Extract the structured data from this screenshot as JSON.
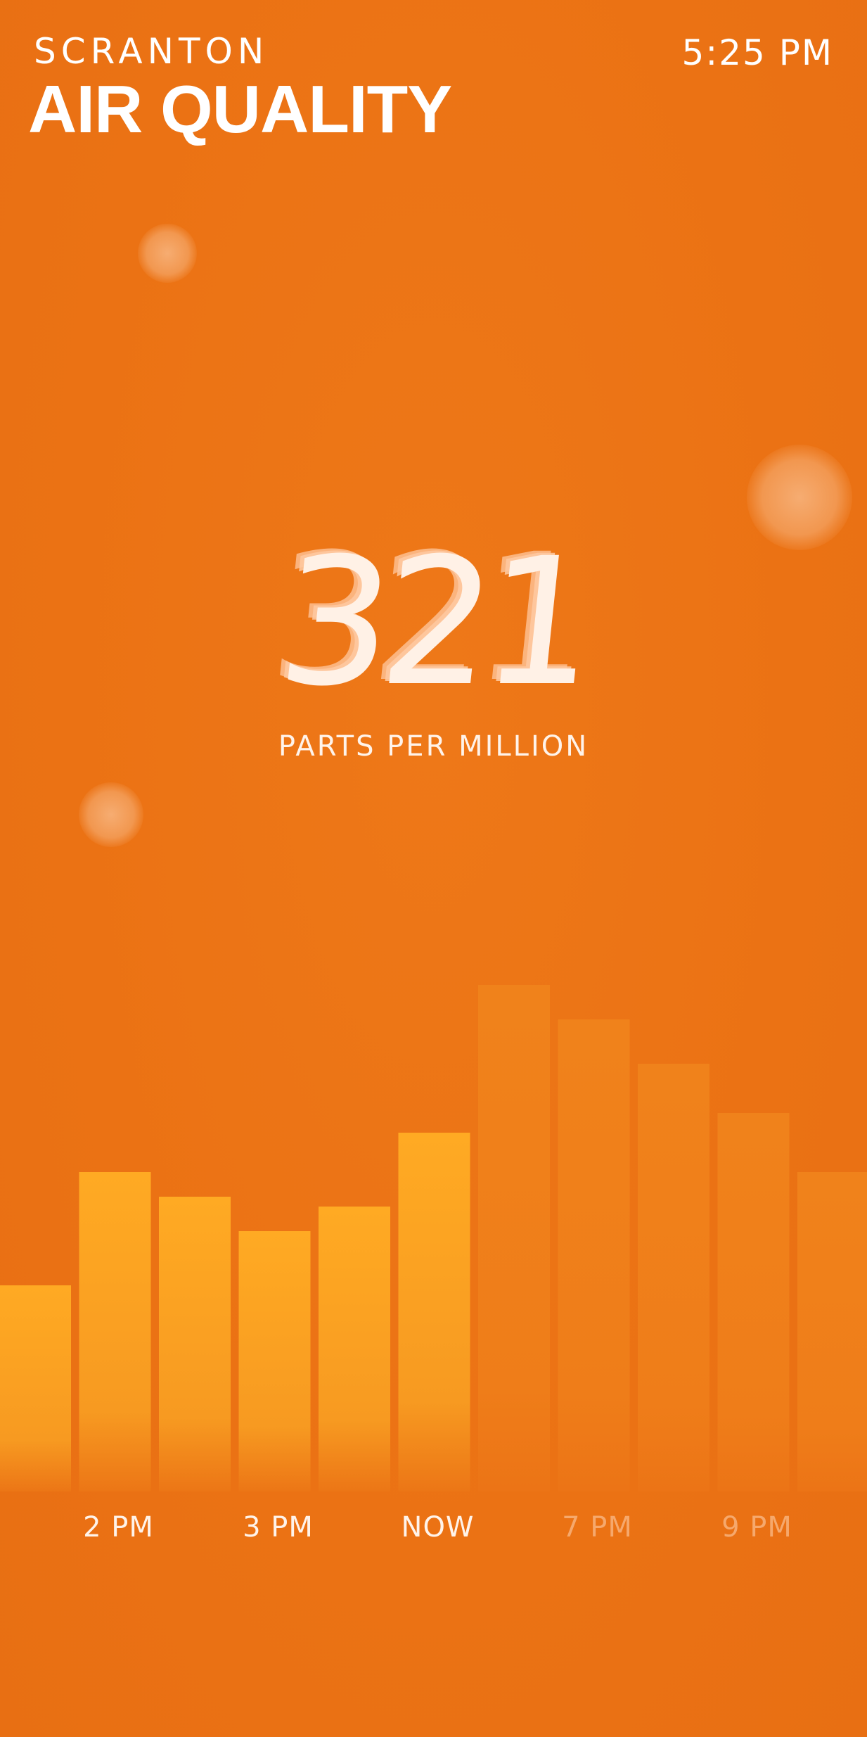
{
  "header": {
    "city": "SCRANTON",
    "title": "AIR QUALITY",
    "time": "5:25 PM"
  },
  "reading": {
    "value": "321",
    "units": "PARTS PER MILLION"
  },
  "colors": {
    "background": "#EC7415",
    "past_bar_top": "#FFAB23",
    "past_bar_bottom": "#F59520",
    "future_bar": "#F0801A",
    "text": "#FFFFFF",
    "future_label": "#FFD6B4"
  },
  "chart_data": {
    "type": "bar",
    "values": [
      0.39,
      0.62,
      0.57,
      0.5,
      0.55,
      0.7,
      1.0,
      0.93,
      0.84,
      0.74,
      0.62
    ],
    "current_index": 5,
    "labels": [
      {
        "text": "2 PM",
        "bar_index": 1.5,
        "future": false
      },
      {
        "text": "3 PM",
        "bar_index": 3.5,
        "future": false
      },
      {
        "text": "NOW",
        "bar_index": 5.5,
        "future": false
      },
      {
        "text": "7 PM",
        "bar_index": 7.5,
        "future": true
      },
      {
        "text": "9 PM",
        "bar_index": 9.5,
        "future": true
      }
    ]
  }
}
